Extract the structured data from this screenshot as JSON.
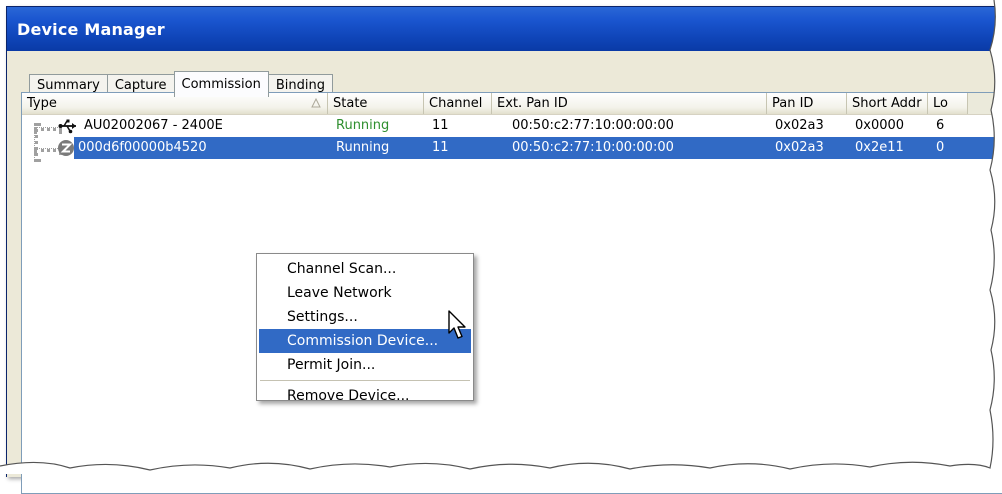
{
  "window": {
    "title": "Device Manager"
  },
  "tabs": [
    {
      "label": "Summary",
      "active": false
    },
    {
      "label": "Capture",
      "active": false
    },
    {
      "label": "Commission",
      "active": true
    },
    {
      "label": "Binding",
      "active": false
    }
  ],
  "toolbar": {
    "icons": [
      "magnifier-icon",
      "broadcast-icon",
      "play-icon"
    ]
  },
  "table": {
    "columns": [
      "Type",
      "State",
      "Channel",
      "Ext. Pan ID",
      "Pan ID",
      "Short Addr",
      "Lo"
    ],
    "rows": [
      {
        "type": "AU02002067 - 2400E",
        "icon": "usb-icon",
        "state": "Running",
        "channel": "11",
        "ext_pan_id": "00:50:c2:77:10:00:00:00",
        "pan_id": "0x02a3",
        "short_addr": "0x0000",
        "lo": "6",
        "selected": false
      },
      {
        "type": "000d6f00000b4520",
        "icon": "zigbee-icon",
        "state": "Running",
        "channel": "11",
        "ext_pan_id": "00:50:c2:77:10:00:00:00",
        "pan_id": "0x02a3",
        "short_addr": "0x2e11",
        "lo": "0",
        "selected": true
      }
    ]
  },
  "context_menu": {
    "items": [
      {
        "label": "Channel Scan...",
        "highlighted": false
      },
      {
        "label": "Leave Network",
        "highlighted": false
      },
      {
        "label": "Settings...",
        "highlighted": false
      },
      {
        "label": "Commission Device...",
        "highlighted": true
      },
      {
        "label": "Permit Join...",
        "highlighted": false
      },
      {
        "label": "Remove Device...",
        "highlighted": false
      }
    ]
  },
  "colors": {
    "title_bar": "#0a3aa6",
    "selection": "#316ac5",
    "running": "#2f8f2f",
    "panel_bg": "#ece9d8"
  }
}
